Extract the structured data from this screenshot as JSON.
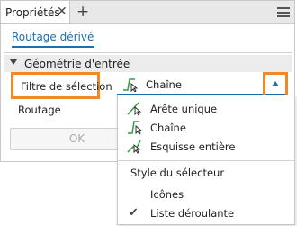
{
  "panel": {
    "tab_label": "Propriétés",
    "close_glyph": "✕",
    "add_glyph": "+"
  },
  "subtab": {
    "label": "Routage dérivé"
  },
  "section": {
    "title": "Géométrie d'entrée"
  },
  "fields": {
    "filter_label": "Filtre de sélection",
    "routage_label": "Routage"
  },
  "select": {
    "value": "Chaîne",
    "icon": "chain-icon"
  },
  "ok_button": {
    "label": "OK"
  },
  "dropdown": {
    "items": [
      {
        "label": "Arête unique",
        "icon": "single-edge-icon"
      },
      {
        "label": "Chaîne",
        "icon": "chain-icon"
      },
      {
        "label": "Esquisse entière",
        "icon": "whole-sketch-icon"
      }
    ],
    "section_title": "Style du sélecteur",
    "style_options": [
      {
        "label": "Icônes",
        "checked": false
      },
      {
        "label": "Liste déroulante",
        "checked": true
      }
    ]
  },
  "colors": {
    "accent": "#1a6fb0",
    "highlight": "#f0892b",
    "icon_green": "#2e9e3e"
  }
}
